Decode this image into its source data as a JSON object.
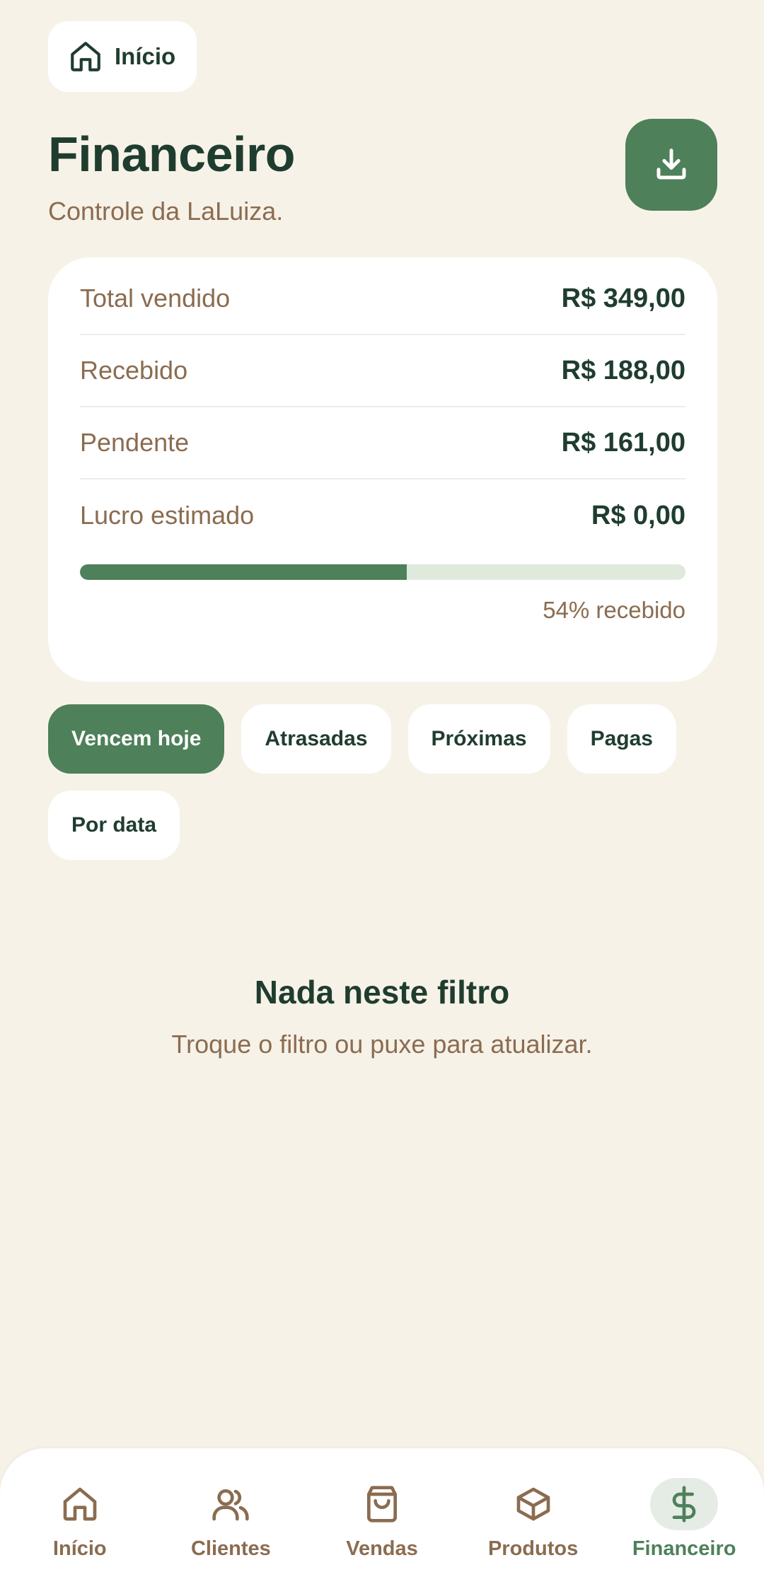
{
  "header": {
    "home_chip_label": "Início",
    "title": "Financeiro",
    "subtitle": "Controle da LaLuiza."
  },
  "summary": {
    "rows": [
      {
        "label": "Total vendido",
        "value": "R$ 349,00"
      },
      {
        "label": "Recebido",
        "value": "R$ 188,00"
      },
      {
        "label": "Pendente",
        "value": "R$ 161,00"
      },
      {
        "label": "Lucro estimado",
        "value": "R$ 0,00"
      }
    ],
    "progress_percent": 54,
    "progress_text": "54% recebido"
  },
  "filters": [
    {
      "label": "Vencem hoje",
      "active": true
    },
    {
      "label": "Atrasadas",
      "active": false
    },
    {
      "label": "Próximas",
      "active": false
    },
    {
      "label": "Pagas",
      "active": false
    },
    {
      "label": "Por data",
      "active": false
    }
  ],
  "empty_state": {
    "title": "Nada neste filtro",
    "subtitle": "Troque o filtro ou puxe para atualizar."
  },
  "nav": [
    {
      "label": "Início",
      "icon": "home-icon"
    },
    {
      "label": "Clientes",
      "icon": "users-icon"
    },
    {
      "label": "Vendas",
      "icon": "shopping-bag-icon"
    },
    {
      "label": "Produtos",
      "icon": "box-icon"
    },
    {
      "label": "Financeiro",
      "icon": "dollar-icon",
      "active": true
    }
  ],
  "colors": {
    "background": "#f7f2e8",
    "primary": "#4e805a",
    "text_dark": "#1f3d2f",
    "text_muted": "#8b6c50"
  }
}
